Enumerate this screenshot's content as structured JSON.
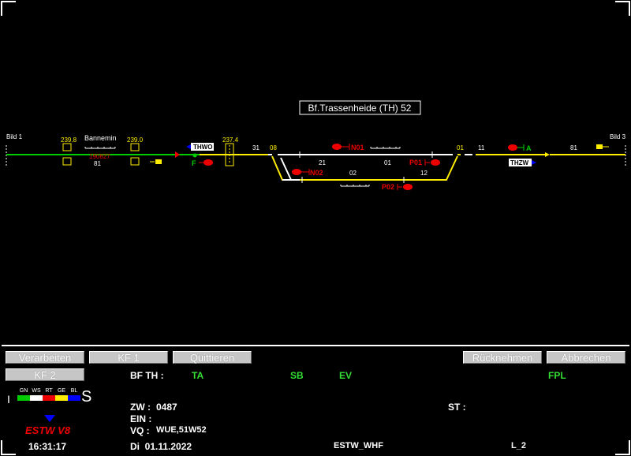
{
  "schematic": {
    "station_title": "Bf.Trassenheide (TH) 52",
    "left_link": "Bild 1",
    "right_link": "Bild 3",
    "km_239_8": "239.8",
    "km_239_0": "239.0",
    "km_237_4": "237.4",
    "bannemin": "Bannemin",
    "block_190827": "190827",
    "track_81_left": "81",
    "thwo": "THWO",
    "f_signal": "F",
    "track_31": "31",
    "switch_08": "08",
    "n01": "N01",
    "n02": "N02",
    "track_21": "21",
    "track_01": "01",
    "track_02": "02",
    "p01": "P01",
    "p02": "P02",
    "track_12": "12",
    "switch_01": "01",
    "track_11": "11",
    "a_signal": "A",
    "track_81_right": "81",
    "thzw": "THZW"
  },
  "buttons": {
    "verarbeiten": "Verarbeiten",
    "kf1": "KF 1",
    "quittieren": "Quittieren",
    "ruecknehmen": "Rücknehmen",
    "abbrechen": "Abbrechen",
    "kf2": "KF 2"
  },
  "status": {
    "bf_th_label": "BF TH :",
    "ta": "TA",
    "sb": "SB",
    "ev": "EV",
    "fpl": "FPL",
    "i_label": "I",
    "s_label": "S",
    "color_keys": [
      "GN",
      "WS",
      "RT",
      "GE",
      "BL"
    ],
    "zw_label": "ZW :",
    "zw_value": "0487",
    "ein_label": "EIN :",
    "vq_label": "VQ :",
    "vq_value": "WUE,51W52",
    "st_label": "ST :",
    "brand": "ESTW V8",
    "time": "16:31:17",
    "date": "Di  01.11.2022",
    "system": "ESTW_WHF",
    "level": "L_2"
  },
  "colors": {
    "track_free": "#ffff00",
    "track_occupied": "#00cc00",
    "signal_stop": "#ee0000",
    "accent_blue": "#0000ff",
    "status_green": "#33dd33"
  }
}
